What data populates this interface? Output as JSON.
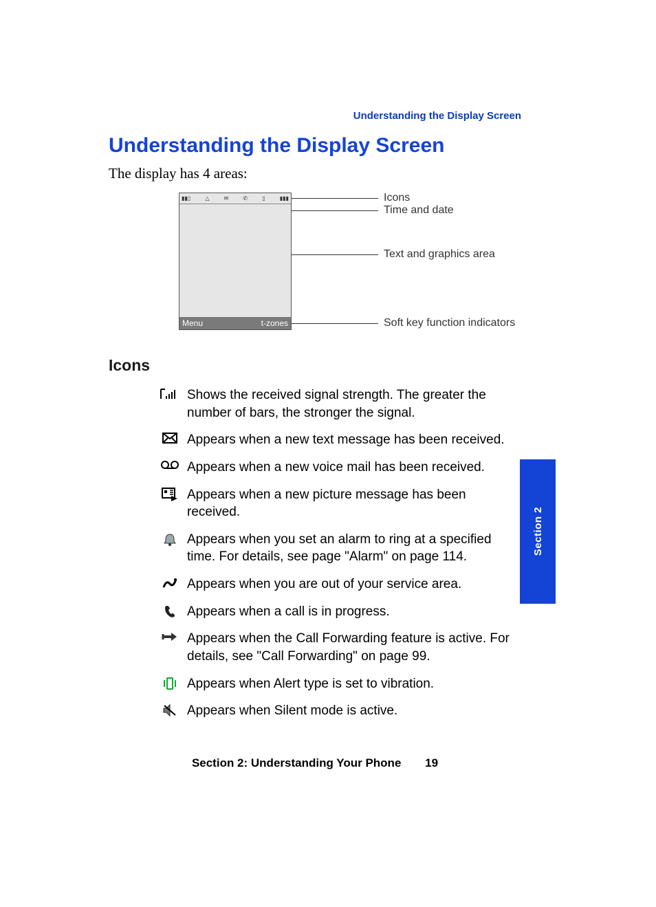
{
  "running_head": "Understanding the Display Screen",
  "title": "Understanding the Display Screen",
  "intro": "The display has 4 areas:",
  "diagram": {
    "soft_left": "Menu",
    "soft_right": "t-zones",
    "labels": {
      "icons": "Icons",
      "time": "Time and date",
      "text_area": "Text and graphics area",
      "softkeys": "Soft key function indicators"
    }
  },
  "icons_heading": "Icons",
  "icons": [
    {
      "name": "signal-strength-icon",
      "desc": "Shows the received signal strength. The greater the number of bars, the stronger the signal."
    },
    {
      "name": "text-message-icon",
      "desc": "Appears when a new text message has been received."
    },
    {
      "name": "voicemail-icon",
      "desc": "Appears when a new voice mail has been received."
    },
    {
      "name": "picture-message-icon",
      "desc": "Appears when a new picture message has been received."
    },
    {
      "name": "alarm-icon",
      "desc": "Appears when you set an alarm to ring at a specified time. For details, see page \"Alarm\" on page 114."
    },
    {
      "name": "no-service-icon",
      "desc": "Appears when you are out of your service area."
    },
    {
      "name": "call-in-progress-icon",
      "desc": "Appears when a call is in progress."
    },
    {
      "name": "call-forwarding-icon",
      "desc": "Appears when the Call Forwarding feature is active. For details, see \"Call Forwarding\" on page 99."
    },
    {
      "name": "vibration-icon",
      "desc": "Appears when Alert type is set to vibration."
    },
    {
      "name": "silent-mode-icon",
      "desc": "Appears when Silent mode is active."
    }
  ],
  "side_tab": "Section 2",
  "footer": {
    "section": "Section 2: Understanding Your Phone",
    "page": "19"
  }
}
